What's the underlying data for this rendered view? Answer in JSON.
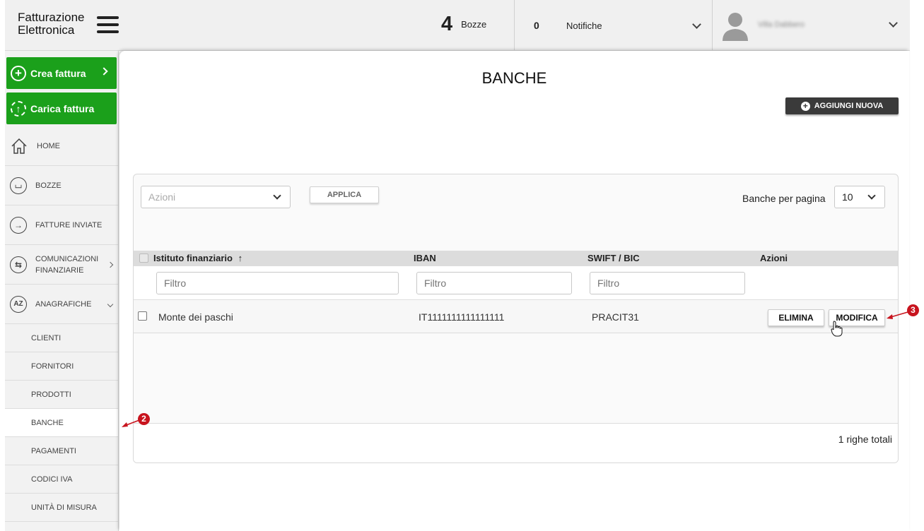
{
  "app": {
    "logo_line1": "Fatturazione",
    "logo_line2": "Elettronica"
  },
  "header": {
    "bozze_count": "4",
    "bozze_label": "Bozze",
    "notifiche_count": "0",
    "notifiche_label": "Notifiche",
    "user_name": "Villa Dabbero"
  },
  "sidebar": {
    "crea_fattura": "Crea fattura",
    "carica_fattura": "Carica fattura",
    "items": [
      {
        "label": "HOME"
      },
      {
        "label": "BOZZE"
      },
      {
        "label": "FATTURE INVIATE"
      },
      {
        "label_line1": "COMUNICAZIONI",
        "label_line2": "FINANZIARIE"
      },
      {
        "label": "ANAGRAFICHE"
      }
    ],
    "subitems": [
      {
        "label": "CLIENTI"
      },
      {
        "label": "FORNITORI"
      },
      {
        "label": "PRODOTTI"
      },
      {
        "label": "BANCHE",
        "active": true
      },
      {
        "label": "PAGAMENTI"
      },
      {
        "label": "CODICI IVA"
      },
      {
        "label": "UNITÀ DI MISURA"
      }
    ],
    "icon_az": "AZ"
  },
  "main": {
    "title": "BANCHE",
    "add_button": "AGGIUNGI NUOVA",
    "actions_placeholder": "Azioni",
    "apply_button": "APPLICA",
    "per_page_label": "Banche per pagina",
    "per_page_value": "10",
    "columns": [
      "Istituto finanziario",
      "IBAN",
      "SWIFT / BIC",
      "Azioni"
    ],
    "sort_icon": "↑",
    "filter_placeholder": "Filtro",
    "rows": [
      {
        "istituto": "Monte dei paschi",
        "iban": "IT1111111111111111",
        "swift": "PRACIT31"
      }
    ],
    "delete_button": "ELIMINA",
    "edit_button": "MODIFICA",
    "total": "1 righe totali"
  },
  "annotations": {
    "step2": "2",
    "step3": "3",
    "color": "#c8141e"
  },
  "colors": {
    "green": "#1ba01b",
    "dark_button": "#3a3a3a"
  }
}
